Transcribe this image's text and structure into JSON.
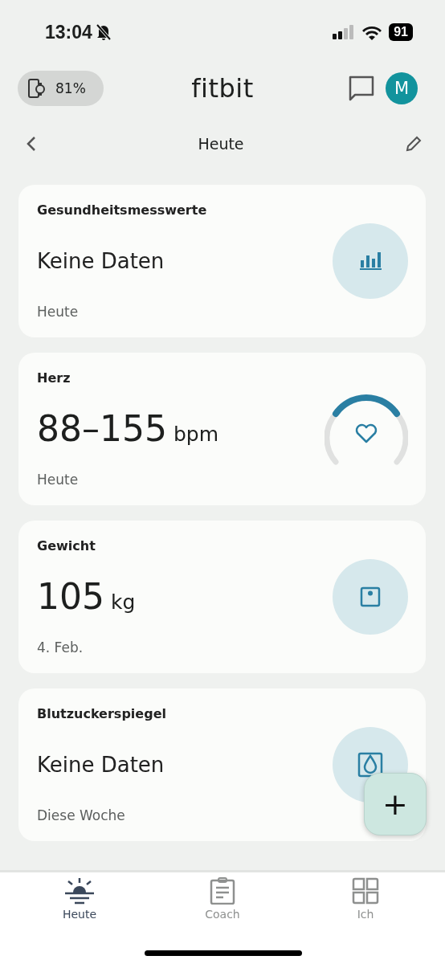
{
  "status_bar": {
    "time": "13:04",
    "battery": "91"
  },
  "header": {
    "device_battery": "81%",
    "logo": "fitbit",
    "avatar": "M"
  },
  "nav": {
    "title": "Heute"
  },
  "cards": [
    {
      "title": "Gesundheitsmesswerte",
      "value": "Keine Daten",
      "subtitle": "Heute",
      "kind": "chart"
    },
    {
      "title": "Herz",
      "value": "88–155",
      "unit": "bpm",
      "subtitle": "Heute",
      "kind": "heart"
    },
    {
      "title": "Gewicht",
      "value": "105",
      "unit": "kg",
      "subtitle": "4. Feb.",
      "kind": "scale"
    },
    {
      "title": "Blutzuckerspiegel",
      "value": "Keine Daten",
      "subtitle": "Diese Woche",
      "kind": "drop"
    }
  ],
  "fab": "+",
  "tabs": [
    {
      "label": "Heute",
      "selected": true,
      "kind": "sun"
    },
    {
      "label": "Coach",
      "selected": false,
      "kind": "clipboard"
    },
    {
      "label": "Ich",
      "selected": false,
      "kind": "grid"
    }
  ]
}
